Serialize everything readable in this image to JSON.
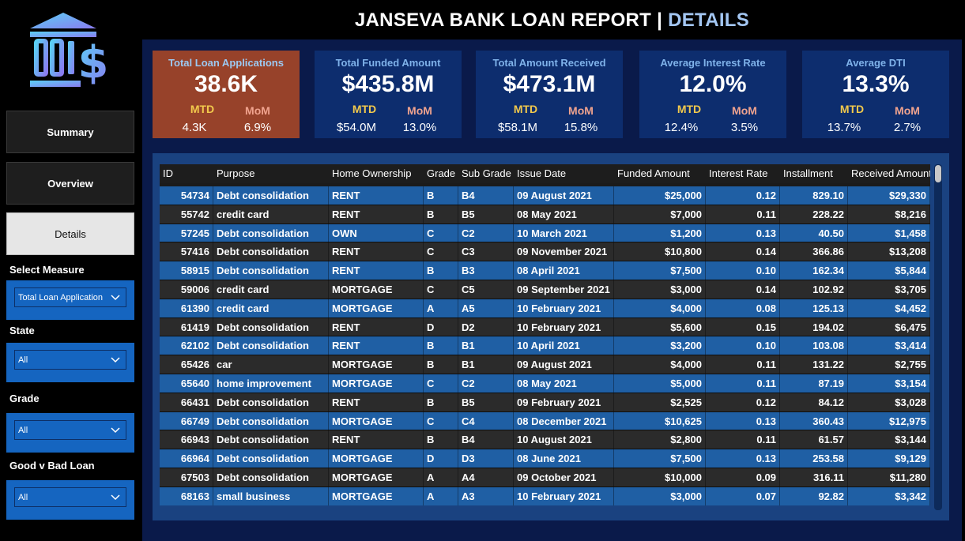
{
  "header": {
    "title": "JANSEVA BANK LOAN REPORT | ",
    "title_highlight": "DETAILS"
  },
  "nav": {
    "summary": "Summary",
    "overview": "Overview",
    "details": "Details"
  },
  "filters": {
    "measure_label": "Select Measure",
    "measure_value": "Total Loan Application",
    "state_label": "State",
    "state_value": "All",
    "grade_label": "Grade",
    "grade_value": "All",
    "loan_label": "Good v Bad Loan",
    "loan_value": "All"
  },
  "kpis": [
    {
      "title": "Total Loan Applications",
      "value": "38.6K",
      "mtd_label": "MTD",
      "mom_label": "MoM",
      "mtd": "4.3K",
      "mom": "6.9%"
    },
    {
      "title": "Total Funded Amount",
      "value": "$435.8M",
      "mtd_label": "MTD",
      "mom_label": "MoM",
      "mtd": "$54.0M",
      "mom": "13.0%"
    },
    {
      "title": "Total Amount Received",
      "value": "$473.1M",
      "mtd_label": "MTD",
      "mom_label": "MoM",
      "mtd": "$58.1M",
      "mom": "15.8%"
    },
    {
      "title": "Average Interest Rate",
      "value": "12.0%",
      "mtd_label": "MTD",
      "mom_label": "MoM",
      "mtd": "12.4%",
      "mom": "3.5%"
    },
    {
      "title": "Average DTI",
      "value": "13.3%",
      "mtd_label": "MTD",
      "mom_label": "MoM",
      "mtd": "13.7%",
      "mom": "2.7%"
    }
  ],
  "colors": {
    "kpi_highlight": "#97422a",
    "kpi_bg": "#0d2d6e",
    "row_odd": "#1f5fa4",
    "row_even": "#2b2b2b",
    "mtd": "#f2c94c",
    "mom": "#f0a38e"
  },
  "table": {
    "columns": [
      "ID",
      "Purpose",
      "Home Ownership",
      "Grade",
      "Sub Grade",
      "Issue Date",
      "Funded Amount",
      "Interest Rate",
      "Installment",
      "Received Amount"
    ],
    "rows": [
      [
        "54734",
        "Debt consolidation",
        "RENT",
        "B",
        "B4",
        "09 August 2021",
        "$25,000",
        "0.12",
        "829.10",
        "$29,330"
      ],
      [
        "55742",
        "credit card",
        "RENT",
        "B",
        "B5",
        "08 May 2021",
        "$7,000",
        "0.11",
        "228.22",
        "$8,216"
      ],
      [
        "57245",
        "Debt consolidation",
        "OWN",
        "C",
        "C2",
        "10 March 2021",
        "$1,200",
        "0.13",
        "40.50",
        "$1,458"
      ],
      [
        "57416",
        "Debt consolidation",
        "RENT",
        "C",
        "C3",
        "09 November 2021",
        "$10,800",
        "0.14",
        "366.86",
        "$13,208"
      ],
      [
        "58915",
        "Debt consolidation",
        "RENT",
        "B",
        "B3",
        "08 April 2021",
        "$7,500",
        "0.10",
        "162.34",
        "$5,844"
      ],
      [
        "59006",
        "credit card",
        "MORTGAGE",
        "C",
        "C5",
        "09 September 2021",
        "$3,000",
        "0.14",
        "102.92",
        "$3,705"
      ],
      [
        "61390",
        "credit card",
        "MORTGAGE",
        "A",
        "A5",
        "10 February 2021",
        "$4,000",
        "0.08",
        "125.13",
        "$4,452"
      ],
      [
        "61419",
        "Debt consolidation",
        "RENT",
        "D",
        "D2",
        "10 February 2021",
        "$5,600",
        "0.15",
        "194.02",
        "$6,475"
      ],
      [
        "62102",
        "Debt consolidation",
        "RENT",
        "B",
        "B1",
        "10 April 2021",
        "$3,200",
        "0.10",
        "103.08",
        "$3,414"
      ],
      [
        "65426",
        "car",
        "MORTGAGE",
        "B",
        "B1",
        "09 August 2021",
        "$4,000",
        "0.11",
        "131.22",
        "$2,755"
      ],
      [
        "65640",
        "home improvement",
        "MORTGAGE",
        "C",
        "C2",
        "08 May 2021",
        "$5,000",
        "0.11",
        "87.19",
        "$3,154"
      ],
      [
        "66431",
        "Debt consolidation",
        "RENT",
        "B",
        "B5",
        "09 February 2021",
        "$2,525",
        "0.12",
        "84.12",
        "$3,028"
      ],
      [
        "66749",
        "Debt consolidation",
        "MORTGAGE",
        "C",
        "C4",
        "08 December 2021",
        "$10,625",
        "0.13",
        "360.43",
        "$12,975"
      ],
      [
        "66943",
        "Debt consolidation",
        "RENT",
        "B",
        "B4",
        "10 August 2021",
        "$2,800",
        "0.11",
        "61.57",
        "$3,144"
      ],
      [
        "66964",
        "Debt consolidation",
        "MORTGAGE",
        "D",
        "D3",
        "08 June 2021",
        "$7,500",
        "0.13",
        "253.58",
        "$9,129"
      ],
      [
        "67503",
        "Debt consolidation",
        "MORTGAGE",
        "A",
        "A4",
        "09 October 2021",
        "$10,000",
        "0.09",
        "316.11",
        "$11,280"
      ],
      [
        "68163",
        "small business",
        "MORTGAGE",
        "A",
        "A3",
        "10 February 2021",
        "$3,000",
        "0.07",
        "92.82",
        "$3,342"
      ]
    ]
  },
  "icons": {
    "logo": "bank-dollar-icon",
    "dropdown": "chevron-down-icon"
  }
}
